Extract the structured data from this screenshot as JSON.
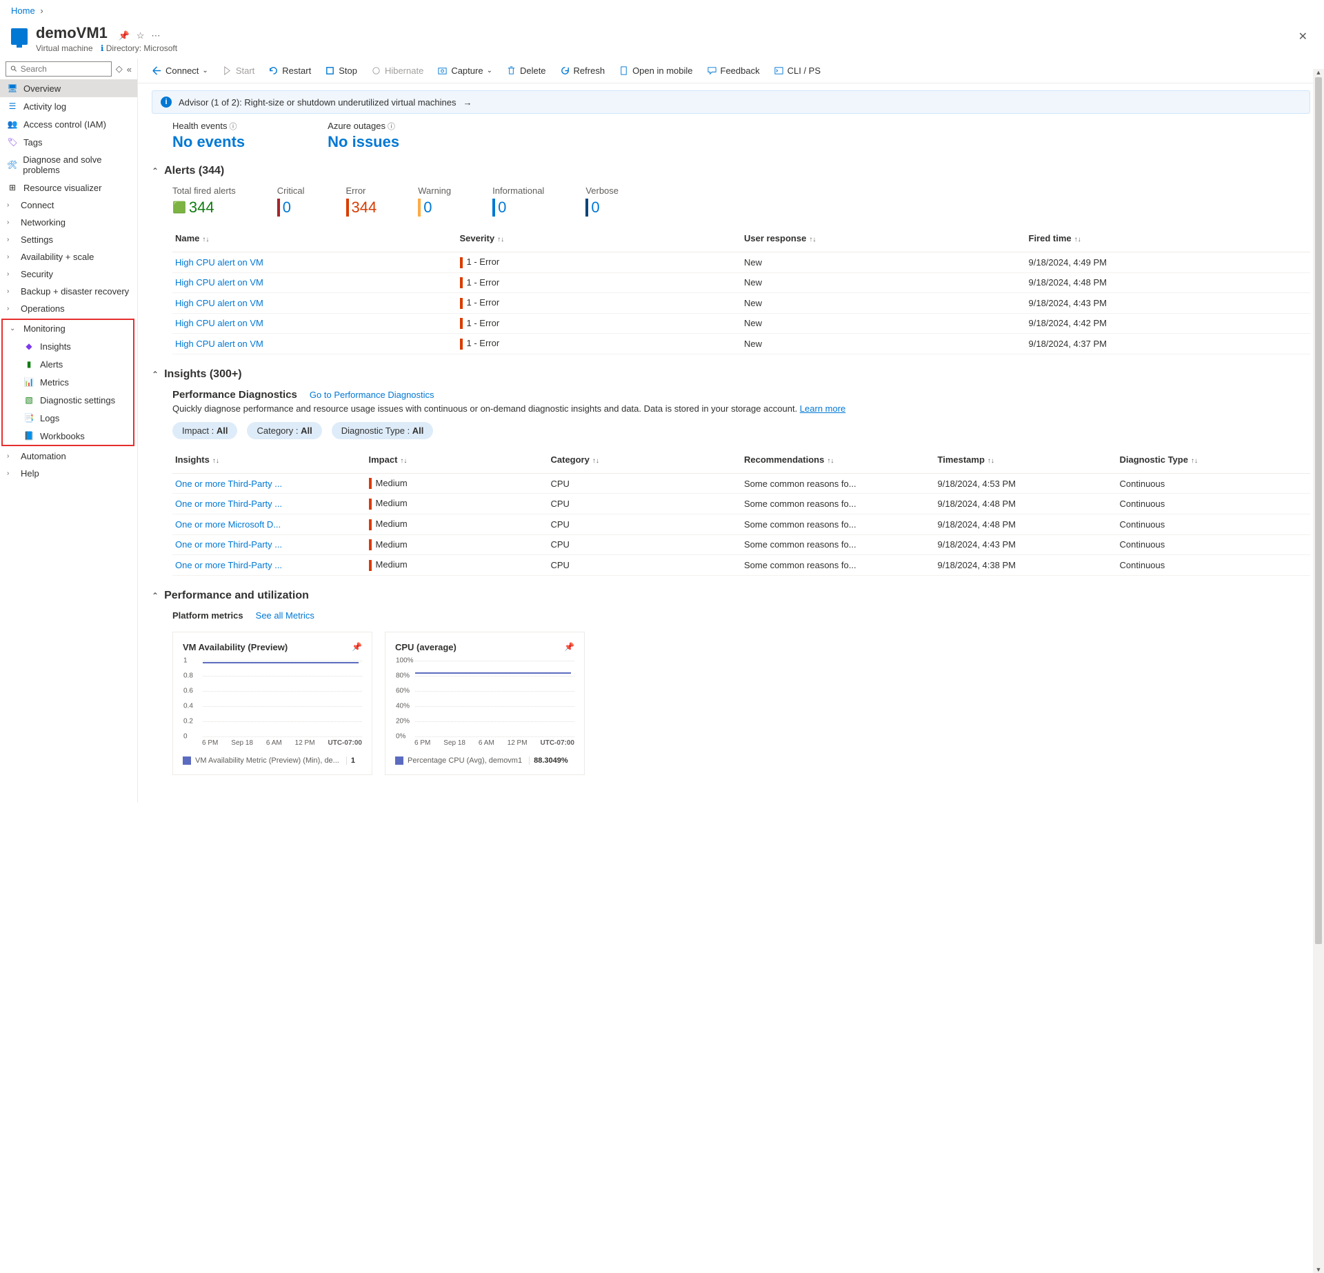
{
  "breadcrumb": {
    "home": "Home"
  },
  "header": {
    "title": "demoVM1",
    "subtitle_type": "Virtual machine",
    "subtitle_dir": "Directory: Microsoft"
  },
  "sidebar": {
    "search_placeholder": "Search",
    "items": {
      "overview": "Overview",
      "activity": "Activity log",
      "access": "Access control (IAM)",
      "tags": "Tags",
      "diagnose": "Diagnose and solve problems",
      "visualizer": "Resource visualizer",
      "connect": "Connect",
      "networking": "Networking",
      "settings": "Settings",
      "availability": "Availability + scale",
      "security": "Security",
      "backup": "Backup + disaster recovery",
      "operations": "Operations",
      "monitoring": "Monitoring",
      "insights": "Insights",
      "alerts": "Alerts",
      "metrics": "Metrics",
      "diag_settings": "Diagnostic settings",
      "logs": "Logs",
      "workbooks": "Workbooks",
      "automation": "Automation",
      "help": "Help"
    }
  },
  "toolbar": {
    "connect": "Connect",
    "start": "Start",
    "restart": "Restart",
    "stop": "Stop",
    "hibernate": "Hibernate",
    "capture": "Capture",
    "delete": "Delete",
    "refresh": "Refresh",
    "openmobile": "Open in mobile",
    "feedback": "Feedback",
    "cli": "CLI / PS"
  },
  "advisor": "Advisor (1 of 2): Right-size or shutdown underutilized virtual machines",
  "health": {
    "events_label": "Health events",
    "events_value": "No events",
    "outages_label": "Azure outages",
    "outages_value": "No issues"
  },
  "alerts": {
    "heading": "Alerts (344)",
    "stats": {
      "total_label": "Total fired alerts",
      "total_val": "344",
      "critical_label": "Critical",
      "critical_val": "0",
      "error_label": "Error",
      "error_val": "344",
      "warning_label": "Warning",
      "warning_val": "0",
      "info_label": "Informational",
      "info_val": "0",
      "verbose_label": "Verbose",
      "verbose_val": "0"
    },
    "cols": {
      "name": "Name",
      "severity": "Severity",
      "response": "User response",
      "fired": "Fired time"
    },
    "rows": [
      {
        "name": "High CPU alert on VM",
        "sev": "1 - Error",
        "resp": "New",
        "time": "9/18/2024, 4:49 PM"
      },
      {
        "name": "High CPU alert on VM",
        "sev": "1 - Error",
        "resp": "New",
        "time": "9/18/2024, 4:48 PM"
      },
      {
        "name": "High CPU alert on VM",
        "sev": "1 - Error",
        "resp": "New",
        "time": "9/18/2024, 4:43 PM"
      },
      {
        "name": "High CPU alert on VM",
        "sev": "1 - Error",
        "resp": "New",
        "time": "9/18/2024, 4:42 PM"
      },
      {
        "name": "High CPU alert on VM",
        "sev": "1 - Error",
        "resp": "New",
        "time": "9/18/2024, 4:37 PM"
      }
    ]
  },
  "insights": {
    "heading": "Insights (300+)",
    "sub_title": "Performance Diagnostics",
    "sub_link": "Go to Performance Diagnostics",
    "desc_pre": "Quickly diagnose performance and resource usage issues with continuous or on-demand diagnostic insights and data. Data is stored in your storage account. ",
    "desc_link": "Learn more",
    "chips": {
      "impact_l": "Impact : ",
      "impact_v": "All",
      "cat_l": "Category : ",
      "cat_v": "All",
      "diag_l": "Diagnostic Type : ",
      "diag_v": "All"
    },
    "cols": {
      "insights": "Insights",
      "impact": "Impact",
      "category": "Category",
      "rec": "Recommendations",
      "ts": "Timestamp",
      "diag": "Diagnostic Type"
    },
    "rows": [
      {
        "ins": "One or more Third-Party ...",
        "imp": "Medium",
        "cat": "CPU",
        "rec": "Some common reasons fo...",
        "ts": "9/18/2024, 4:53 PM",
        "diag": "Continuous"
      },
      {
        "ins": "One or more Third-Party ...",
        "imp": "Medium",
        "cat": "CPU",
        "rec": "Some common reasons fo...",
        "ts": "9/18/2024, 4:48 PM",
        "diag": "Continuous"
      },
      {
        "ins": "One or more Microsoft D...",
        "imp": "Medium",
        "cat": "CPU",
        "rec": "Some common reasons fo...",
        "ts": "9/18/2024, 4:48 PM",
        "diag": "Continuous"
      },
      {
        "ins": "One or more Third-Party ...",
        "imp": "Medium",
        "cat": "CPU",
        "rec": "Some common reasons fo...",
        "ts": "9/18/2024, 4:43 PM",
        "diag": "Continuous"
      },
      {
        "ins": "One or more Third-Party ...",
        "imp": "Medium",
        "cat": "CPU",
        "rec": "Some common reasons fo...",
        "ts": "9/18/2024, 4:38 PM",
        "diag": "Continuous"
      }
    ]
  },
  "perf": {
    "heading": "Performance and utilization",
    "platform": "Platform metrics",
    "see_all": "See all Metrics"
  },
  "chart_data": [
    {
      "type": "line",
      "title": "VM Availability (Preview)",
      "ylim": [
        0,
        1
      ],
      "yticks": [
        "1",
        "0.8",
        "0.6",
        "0.4",
        "0.2",
        "0"
      ],
      "xticks": [
        "6 PM",
        "Sep 18",
        "6 AM",
        "12 PM"
      ],
      "tz": "UTC-07:00",
      "series_name": "VM Availability Metric (Preview) (Min), de...",
      "series_value": "1",
      "line_y_percent": 2
    },
    {
      "type": "line",
      "title": "CPU (average)",
      "ylim": [
        0,
        100
      ],
      "yticks": [
        "100%",
        "80%",
        "60%",
        "40%",
        "20%",
        "0%"
      ],
      "xticks": [
        "6 PM",
        "Sep 18",
        "6 AM",
        "12 PM"
      ],
      "tz": "UTC-07:00",
      "series_name": "Percentage CPU (Avg), demovm1",
      "series_value": "88.3049%",
      "line_y_percent": 16
    }
  ]
}
